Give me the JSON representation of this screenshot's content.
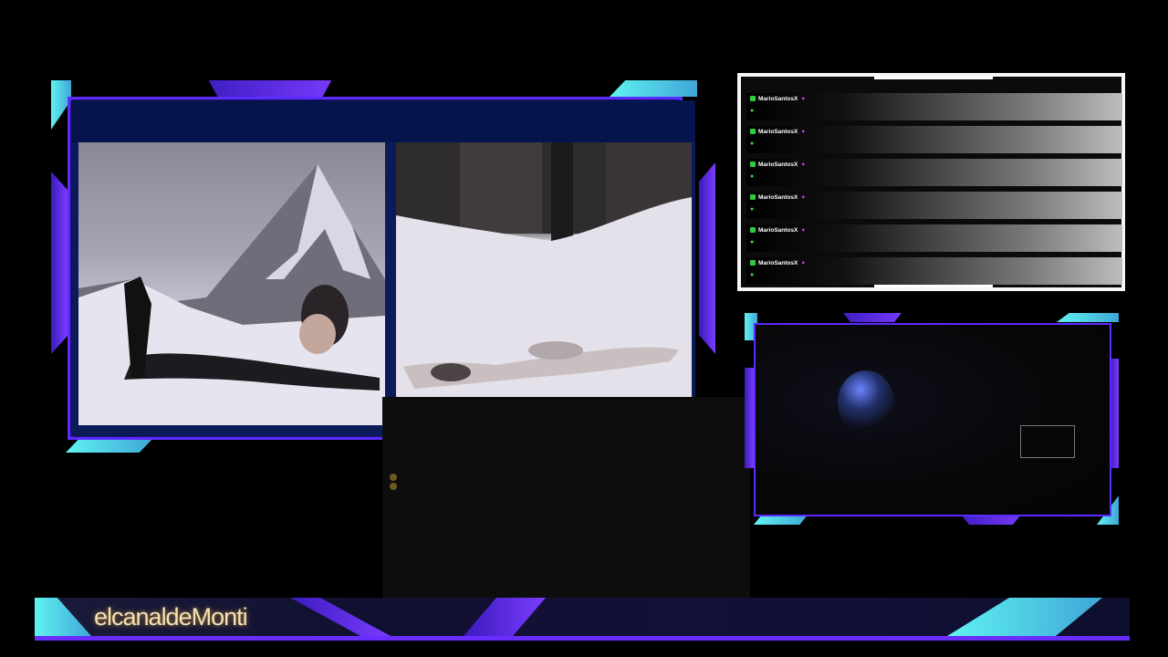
{
  "banner": {
    "title": "elcanaldeMonti"
  },
  "chat": {
    "messages": [
      {
        "user": "MarioSantosX"
      },
      {
        "user": "MarioSantosX"
      },
      {
        "user": "MarioSantosX"
      },
      {
        "user": "MarioSantosX"
      },
      {
        "user": "MarioSantosX"
      },
      {
        "user": "MarioSantosX"
      }
    ]
  },
  "colors": {
    "accent_purple": "#5b2bff",
    "accent_cyan": "#5ff3f0",
    "chat_badge": "#2ecc40"
  }
}
